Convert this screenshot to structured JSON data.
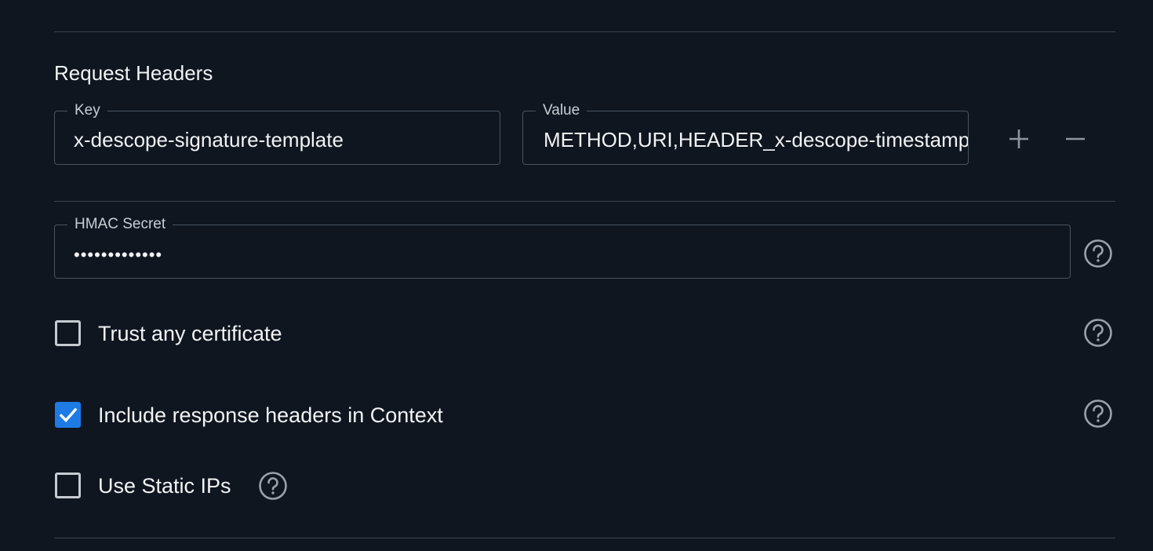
{
  "request_headers": {
    "title": "Request Headers",
    "rows": [
      {
        "key_label": "Key",
        "key_value": "x-descope-signature-template",
        "value_label": "Value",
        "value_value": "METHOD,URI,HEADER_x-descope-timestamp"
      }
    ],
    "add_icon": "plus-icon",
    "remove_icon": "minus-icon"
  },
  "hmac": {
    "label": "HMAC Secret",
    "value": "•••••••••••••",
    "help_icon": "help-icon"
  },
  "options": [
    {
      "label": "Trust any certificate",
      "checked": false
    },
    {
      "label": "Include response headers in Context",
      "checked": true
    },
    {
      "label": "Use Static IPs",
      "checked": false
    }
  ],
  "colors": {
    "background": "#0f1620",
    "accent": "#1e7be6",
    "border": "#4a5360",
    "divider": "#3a4350"
  }
}
